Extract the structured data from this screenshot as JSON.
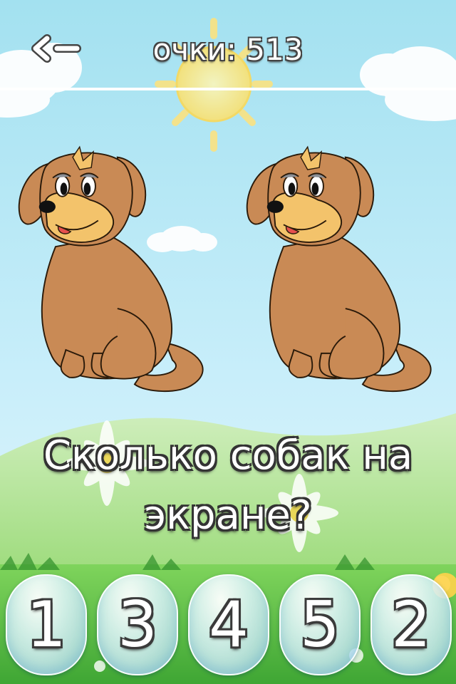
{
  "header": {
    "back_label": "<-",
    "score_label": "очки",
    "score_separator": ":",
    "score_value": "513"
  },
  "question": "Сколько собак на экране?",
  "answers": [
    "1",
    "3",
    "4",
    "5",
    "2"
  ],
  "scene": {
    "dog_count": 2
  },
  "colors": {
    "sky_top": "#a9e3f0",
    "sky_bottom": "#dff4fb",
    "grass": "#5fc04a",
    "dog_body": "#c98a55",
    "dog_muzzle": "#f3c36b",
    "sun": "#ffe46a"
  }
}
